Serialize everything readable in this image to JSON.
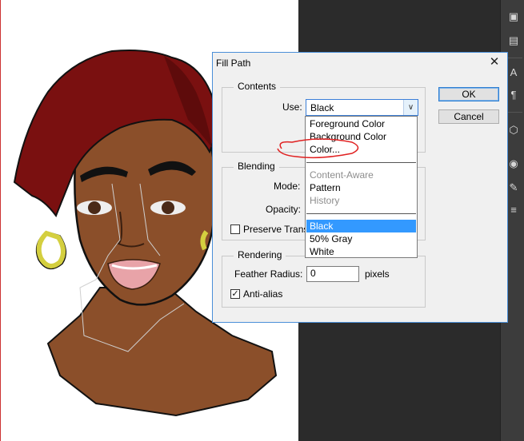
{
  "dialog": {
    "title": "Fill Path",
    "close_glyph": "✕",
    "ok_label": "OK",
    "cancel_label": "Cancel",
    "contents": {
      "group_label": "Contents",
      "use_label": "Use:",
      "use_value": "Black"
    },
    "blending": {
      "group_label": "Blending",
      "mode_label": "Mode:",
      "opacity_label": "Opacity:",
      "preserve_label": "Preserve Trans"
    },
    "rendering": {
      "group_label": "Rendering",
      "feather_label": "Feather Radius:",
      "feather_value": "0",
      "feather_unit": "pixels",
      "antialias_label": "Anti-alias",
      "antialias_checked": true
    }
  },
  "dropdown": {
    "items": [
      {
        "label": "Foreground Color",
        "state": "normal"
      },
      {
        "label": "Background Color",
        "state": "normal"
      },
      {
        "label": "Color...",
        "state": "normal"
      },
      {
        "label": "Content-Aware",
        "state": "disabled"
      },
      {
        "label": "Pattern",
        "state": "normal"
      },
      {
        "label": "History",
        "state": "disabled"
      },
      {
        "label": "Black",
        "state": "selected"
      },
      {
        "label": "50% Gray",
        "state": "normal"
      },
      {
        "label": "White",
        "state": "normal"
      }
    ]
  },
  "toolbar": {
    "icons": [
      "cube-stack-icon",
      "layers-icon",
      "character-icon",
      "paragraph-icon",
      "3d-cube-icon",
      "color-wheel-icon",
      "brush-icon",
      "sliders-icon"
    ],
    "glyphs": [
      "▣",
      "▤",
      "A",
      "¶",
      "⬡",
      "◉",
      "✎",
      "≡"
    ]
  },
  "colors": {
    "accent": "#3399ff",
    "annotation": "#e02020",
    "hair": "#7a1010",
    "skin": "#8b4f2a",
    "earring": "#d4cf3f"
  }
}
